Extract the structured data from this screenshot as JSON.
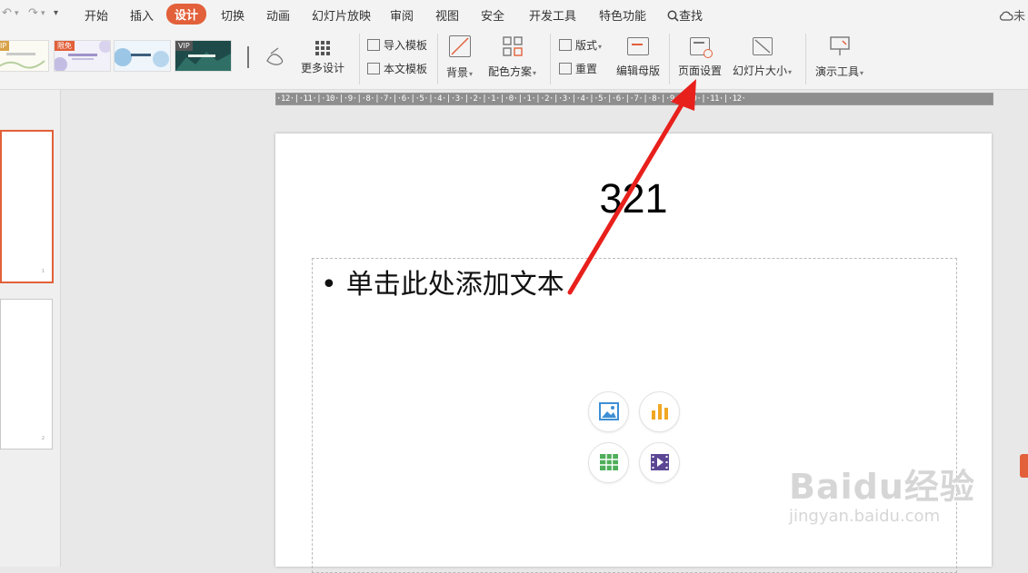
{
  "menubar": {
    "items": [
      {
        "label": "开始"
      },
      {
        "label": "插入"
      },
      {
        "label": "设计"
      },
      {
        "label": "切换"
      },
      {
        "label": "动画"
      },
      {
        "label": "幻灯片放映"
      },
      {
        "label": "审阅"
      },
      {
        "label": "视图"
      },
      {
        "label": "安全"
      },
      {
        "label": "开发工具"
      },
      {
        "label": "特色功能"
      }
    ],
    "active_tab": "设计",
    "search_label": "查找",
    "cloud_label": "未"
  },
  "ribbon": {
    "template_badges": [
      "IP",
      "限免",
      "VIP"
    ],
    "more_design": "更多设计",
    "import_template": "导入模板",
    "this_template": "本文模板",
    "background": "背景",
    "color_scheme": "配色方案",
    "layout": "版式",
    "reset": "重置",
    "edit_master": "编辑母版",
    "page_setup": "页面设置",
    "slide_size": "幻灯片大小",
    "presentation_tools": "演示工具"
  },
  "ruler": {
    "text": "·12·|·11·|·10·|·9·|·8·|·7·|·6·|·5·|·4·|·3·|·2·|·1·|·0·|·1·|·2·|·3·|·4·|·5·|·6·|·7·|·8·|·9·|·10·|·11·|·12·"
  },
  "slide": {
    "title": "321",
    "bullet": "单击此处添加文本"
  },
  "thumbnails": [
    {
      "number": "1"
    },
    {
      "number": "2"
    }
  ],
  "watermark": {
    "main": "Baidu经验",
    "sub": "jingyan.baidu.com"
  },
  "colors": {
    "accent": "#e2603a",
    "arrow": "#e8201c"
  }
}
